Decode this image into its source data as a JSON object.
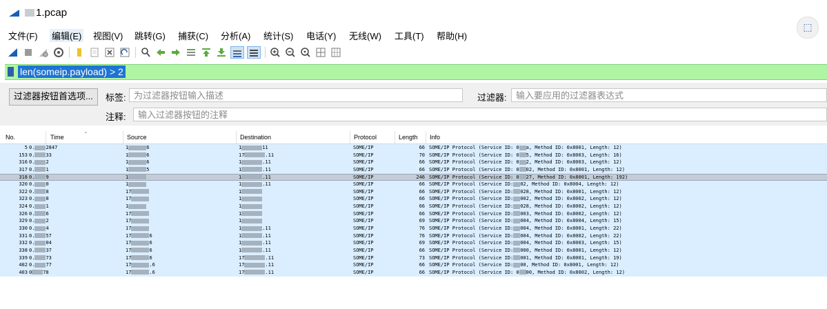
{
  "window": {
    "title": "1.pcap"
  },
  "menu": [
    "文件(F)",
    "编辑(E)",
    "视图(V)",
    "跳转(G)",
    "捕获(C)",
    "分析(A)",
    "统计(S)",
    "电话(Y)",
    "无线(W)",
    "工具(T)",
    "帮助(H)"
  ],
  "toolbar_icons": [
    "shark-fin-start-icon",
    "stop-icon",
    "restart-icon",
    "options-icon",
    "open-file-icon",
    "save-file-icon",
    "close-file-icon",
    "reload-icon",
    "find-icon",
    "back-arrow-icon",
    "forward-arrow-icon",
    "go-to-packet-icon",
    "first-packet-icon",
    "last-packet-icon",
    "auto-scroll-icon",
    "colorize-icon",
    "zoom-in-icon",
    "zoom-out-icon",
    "normal-size-icon",
    "resize-columns-icon"
  ],
  "filter": {
    "text": "len(someip.payload) > 2"
  },
  "filter_button_panel": {
    "prefs_button": "过滤器按钮首选项...",
    "label_caption": "标签:",
    "label_placeholder": "为过滤器按钮输入描述",
    "filter_caption": "过滤器:",
    "filter_placeholder": "输入要应用的过滤器表达式",
    "comment_caption": "注释:",
    "comment_placeholder": "输入过滤器按钮的注释"
  },
  "columns": [
    "No.",
    "Time",
    "Source",
    "Destination",
    "Protocol",
    "Length",
    "Info"
  ],
  "packets": [
    {
      "no": "5",
      "time_a": "0.",
      "time_b": "2847",
      "src_a": "1",
      "src_b": "6",
      "dst_a": "1",
      "dst_b": "11",
      "proto": "SOME/IP",
      "len": "66",
      "info_a": "SOME/IP Protocol (Service ID: 0",
      "info_b": "a, Method ID: 0x8001, Length: 12)",
      "selected": false
    },
    {
      "no": "153",
      "time_a": "0.",
      "time_b": "33",
      "src_a": "1",
      "src_b": "6",
      "dst_a": "17",
      "dst_b": ".11",
      "proto": "SOME/IP",
      "len": "70",
      "info_a": "SOME/IP Protocol (Service ID: 0",
      "info_b": "5, Method ID: 0x8003, Length: 16)",
      "selected": false
    },
    {
      "no": "316",
      "time_a": "0.",
      "time_b": "2",
      "src_a": "1",
      "src_b": "6",
      "dst_a": "1",
      "dst_b": ".11",
      "proto": "SOME/IP",
      "len": "66",
      "info_a": "SOME/IP Protocol (Service ID: 0",
      "info_b": "2, Method ID: 0x8003, Length: 12)",
      "selected": false
    },
    {
      "no": "317",
      "time_a": "0.",
      "time_b": "1",
      "src_a": "1",
      "src_b": "5",
      "dst_a": "1",
      "dst_b": ".11",
      "proto": "SOME/IP",
      "len": "66",
      "info_a": "SOME/IP Protocol (Service ID: 0",
      "info_b": "02, Method ID: 0x8001, Length: 12)",
      "selected": false
    },
    {
      "no": "318",
      "time_a": "0.",
      "time_b": "9",
      "src_a": "1",
      "src_b": "",
      "dst_a": "1",
      "dst_b": ".11",
      "proto": "SOME/IP",
      "len": "246",
      "info_a": "SOME/IP Protocol (Service ID: 0",
      "info_b": "27, Method ID: 0x8001, Length: 192)",
      "selected": true
    },
    {
      "no": "320",
      "time_a": "0.",
      "time_b": "0",
      "src_a": "1",
      "src_b": "",
      "dst_a": "1",
      "dst_b": ".11",
      "proto": "SOME/IP",
      "len": "66",
      "info_a": "SOME/IP Protocol (Service ID:",
      "info_b": "02, Method ID: 0x8004, Length: 12)",
      "selected": false
    },
    {
      "no": "322",
      "time_a": "0.",
      "time_b": "8",
      "src_a": "17",
      "src_b": "",
      "dst_a": "1",
      "dst_b": "",
      "proto": "SOME/IP",
      "len": "66",
      "info_a": "SOME/IP Protocol (Service ID:",
      "info_b": "028, Method ID: 0x8001, Length: 12)",
      "selected": false
    },
    {
      "no": "323",
      "time_a": "0.",
      "time_b": "8",
      "src_a": "17",
      "src_b": "",
      "dst_a": "1",
      "dst_b": "",
      "proto": "SOME/IP",
      "len": "66",
      "info_a": "SOME/IP Protocol (Service ID:",
      "info_b": "002, Method ID: 0x8002, Length: 12)",
      "selected": false
    },
    {
      "no": "324",
      "time_a": "0.",
      "time_b": "1",
      "src_a": "1",
      "src_b": "",
      "dst_a": "1",
      "dst_b": "",
      "proto": "SOME/IP",
      "len": "66",
      "info_a": "SOME/IP Protocol (Service ID:",
      "info_b": "028, Method ID: 0x8002, Length: 12)",
      "selected": false
    },
    {
      "no": "326",
      "time_a": "0.",
      "time_b": "6",
      "src_a": "17",
      "src_b": "",
      "dst_a": "1",
      "dst_b": "",
      "proto": "SOME/IP",
      "len": "66",
      "info_a": "SOME/IP Protocol (Service ID:",
      "info_b": "003, Method ID: 0x8002, Length: 12)",
      "selected": false
    },
    {
      "no": "329",
      "time_a": "0.",
      "time_b": "2",
      "src_a": "17",
      "src_b": "",
      "dst_a": "1",
      "dst_b": "",
      "proto": "SOME/IP",
      "len": "69",
      "info_a": "SOME/IP Protocol (Service ID:",
      "info_b": "004, Method ID: 0x8004, Length: 15)",
      "selected": false
    },
    {
      "no": "330",
      "time_a": "0.",
      "time_b": "4",
      "src_a": "17",
      "src_b": "",
      "dst_a": "1",
      "dst_b": ".11",
      "proto": "SOME/IP",
      "len": "76",
      "info_a": "SOME/IP Protocol (Service ID:",
      "info_b": "004, Method ID: 0x8001, Length: 22)",
      "selected": false
    },
    {
      "no": "331",
      "time_a": "0.",
      "time_b": "57",
      "src_a": "17",
      "src_b": "6",
      "dst_a": "1",
      "dst_b": ".11",
      "proto": "SOME/IP",
      "len": "76",
      "info_a": "SOME/IP Protocol (Service ID:",
      "info_b": "004, Method ID: 0x8002, Length: 22)",
      "selected": false
    },
    {
      "no": "332",
      "time_a": "0.",
      "time_b": "04",
      "src_a": "17",
      "src_b": "6",
      "dst_a": "1",
      "dst_b": ".11",
      "proto": "SOME/IP",
      "len": "69",
      "info_a": "SOME/IP Protocol (Service ID:",
      "info_b": "004, Method ID: 0x8003, Length: 15)",
      "selected": false
    },
    {
      "no": "338",
      "time_a": "0.",
      "time_b": "37",
      "src_a": "17",
      "src_b": "6",
      "dst_a": "1",
      "dst_b": ".11",
      "proto": "SOME/IP",
      "len": "66",
      "info_a": "SOME/IP Protocol (Service ID:",
      "info_b": "000, Method ID: 0x8001, Length: 12)",
      "selected": false
    },
    {
      "no": "339",
      "time_a": "0.",
      "time_b": "73",
      "src_a": "17",
      "src_b": "6",
      "dst_a": "17",
      "dst_b": ".11",
      "proto": "SOME/IP",
      "len": "73",
      "info_a": "SOME/IP Protocol (Service ID:",
      "info_b": "001, Method ID: 0x8001, Length: 19)",
      "selected": false
    },
    {
      "no": "402",
      "time_a": "0.",
      "time_b": "77",
      "src_a": "17",
      "src_b": ".6",
      "dst_a": "17",
      "dst_b": ".11",
      "proto": "SOME/IP",
      "len": "66",
      "info_a": "SOME/IP Protocol (Service ID:",
      "info_b": "00, Method ID: 0x8001, Length: 12)",
      "selected": false
    },
    {
      "no": "403",
      "time_a": "0",
      "time_b": "78",
      "src_a": "17",
      "src_b": ".6",
      "dst_a": "17",
      "dst_b": ".11",
      "proto": "SOME/IP",
      "len": "66",
      "info_a": "SOME/IP Protocol (Service ID: 0",
      "info_b": "00, Method ID: 0x8002, Length: 12)",
      "selected": false
    }
  ],
  "colors": {
    "filter_valid_bg": "#aff5a3",
    "row_bg": "#daeeff",
    "selected_row_bg": "#c4cdd7",
    "accent": "#1e74d3"
  }
}
